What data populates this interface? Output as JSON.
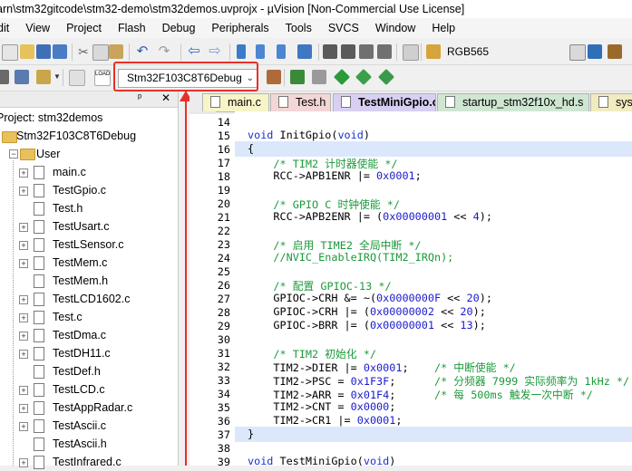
{
  "window": {
    "title": "arn\\stm32gitcode\\stm32-demo\\stm32demos.uvprojx - µVision  [Non-Commercial Use License]"
  },
  "menu": [
    "dit",
    "View",
    "Project",
    "Flash",
    "Debug",
    "Peripherals",
    "Tools",
    "SVCS",
    "Window",
    "Help"
  ],
  "toolbar": {
    "color_format": "RGB565",
    "target_select": "Stm32F103C8T6Debug"
  },
  "project": {
    "header_pin": "ᵖ",
    "header_close": "✕",
    "root": "Project: stm32demos",
    "target": "Stm32F103C8T6Debug",
    "group": "User",
    "files": [
      "main.c",
      "TestGpio.c",
      "Test.h",
      "TestUsart.c",
      "TestLSensor.c",
      "TestMem.c",
      "TestMem.h",
      "TestLCD1602.c",
      "Test.c",
      "TestDma.c",
      "TestDH11.c",
      "TestDef.h",
      "TestLCD.c",
      "TestAppRadar.c",
      "TestAscii.c",
      "TestAscii.h",
      "TestInfrared.c"
    ],
    "expandable": [
      true,
      true,
      false,
      true,
      true,
      true,
      false,
      true,
      true,
      true,
      true,
      false,
      true,
      true,
      true,
      false,
      true
    ]
  },
  "editor": {
    "tabs": [
      "main.c",
      "Test.h",
      "TestMiniGpio.c",
      "startup_stm32f10x_hd.s",
      "sys"
    ],
    "active_tab": 2,
    "lines": [
      {
        "n": "14",
        "t": ""
      },
      {
        "n": "15",
        "t": "void InitGpio(void)"
      },
      {
        "n": "16",
        "t": "{"
      },
      {
        "n": "17",
        "t": "    /* TIM2 计时器使能 */"
      },
      {
        "n": "18",
        "t": "    RCC->APB1ENR |= 0x0001;"
      },
      {
        "n": "19",
        "t": ""
      },
      {
        "n": "20",
        "t": "    /* GPIO C 时钟使能 */"
      },
      {
        "n": "21",
        "t": "    RCC->APB2ENR |= (0x00000001 << 4);"
      },
      {
        "n": "22",
        "t": ""
      },
      {
        "n": "23",
        "t": "    /* 启用 TIME2 全局中断 */"
      },
      {
        "n": "24",
        "t": "    //NVIC_EnableIRQ(TIM2_IRQn);"
      },
      {
        "n": "25",
        "t": ""
      },
      {
        "n": "26",
        "t": "    /* 配置 GPIOC-13 */"
      },
      {
        "n": "27",
        "t": "    GPIOC->CRH &= ~(0x0000000F << 20);"
      },
      {
        "n": "28",
        "t": "    GPIOC->CRH |= (0x00000002 << 20);"
      },
      {
        "n": "29",
        "t": "    GPIOC->BRR |= (0x00000001 << 13);"
      },
      {
        "n": "30",
        "t": ""
      },
      {
        "n": "31",
        "t": "    /* TIM2 初始化 */"
      },
      {
        "n": "32",
        "t": "    TIM2->DIER |= 0x0001;    /* 中断使能 */"
      },
      {
        "n": "33",
        "t": "    TIM2->PSC = 0x1F3F;      /* 分频器 7999 实际频率为 1kHz */"
      },
      {
        "n": "34",
        "t": "    TIM2->ARR = 0x01F4;      /* 每 500ms 触发一次中断 */"
      },
      {
        "n": "35",
        "t": "    TIM2->CNT = 0x0000;"
      },
      {
        "n": "36",
        "t": "    TIM2->CR1 |= 0x0001;"
      },
      {
        "n": "37",
        "t": "}"
      },
      {
        "n": "38",
        "t": ""
      },
      {
        "n": "39",
        "t": "void TestMiniGpio(void)"
      }
    ]
  },
  "colors": {
    "highlight": "#e8302a",
    "comment": "#1b9a3a",
    "keyword": "#1a2fd0",
    "number": "#1a1ad0"
  }
}
